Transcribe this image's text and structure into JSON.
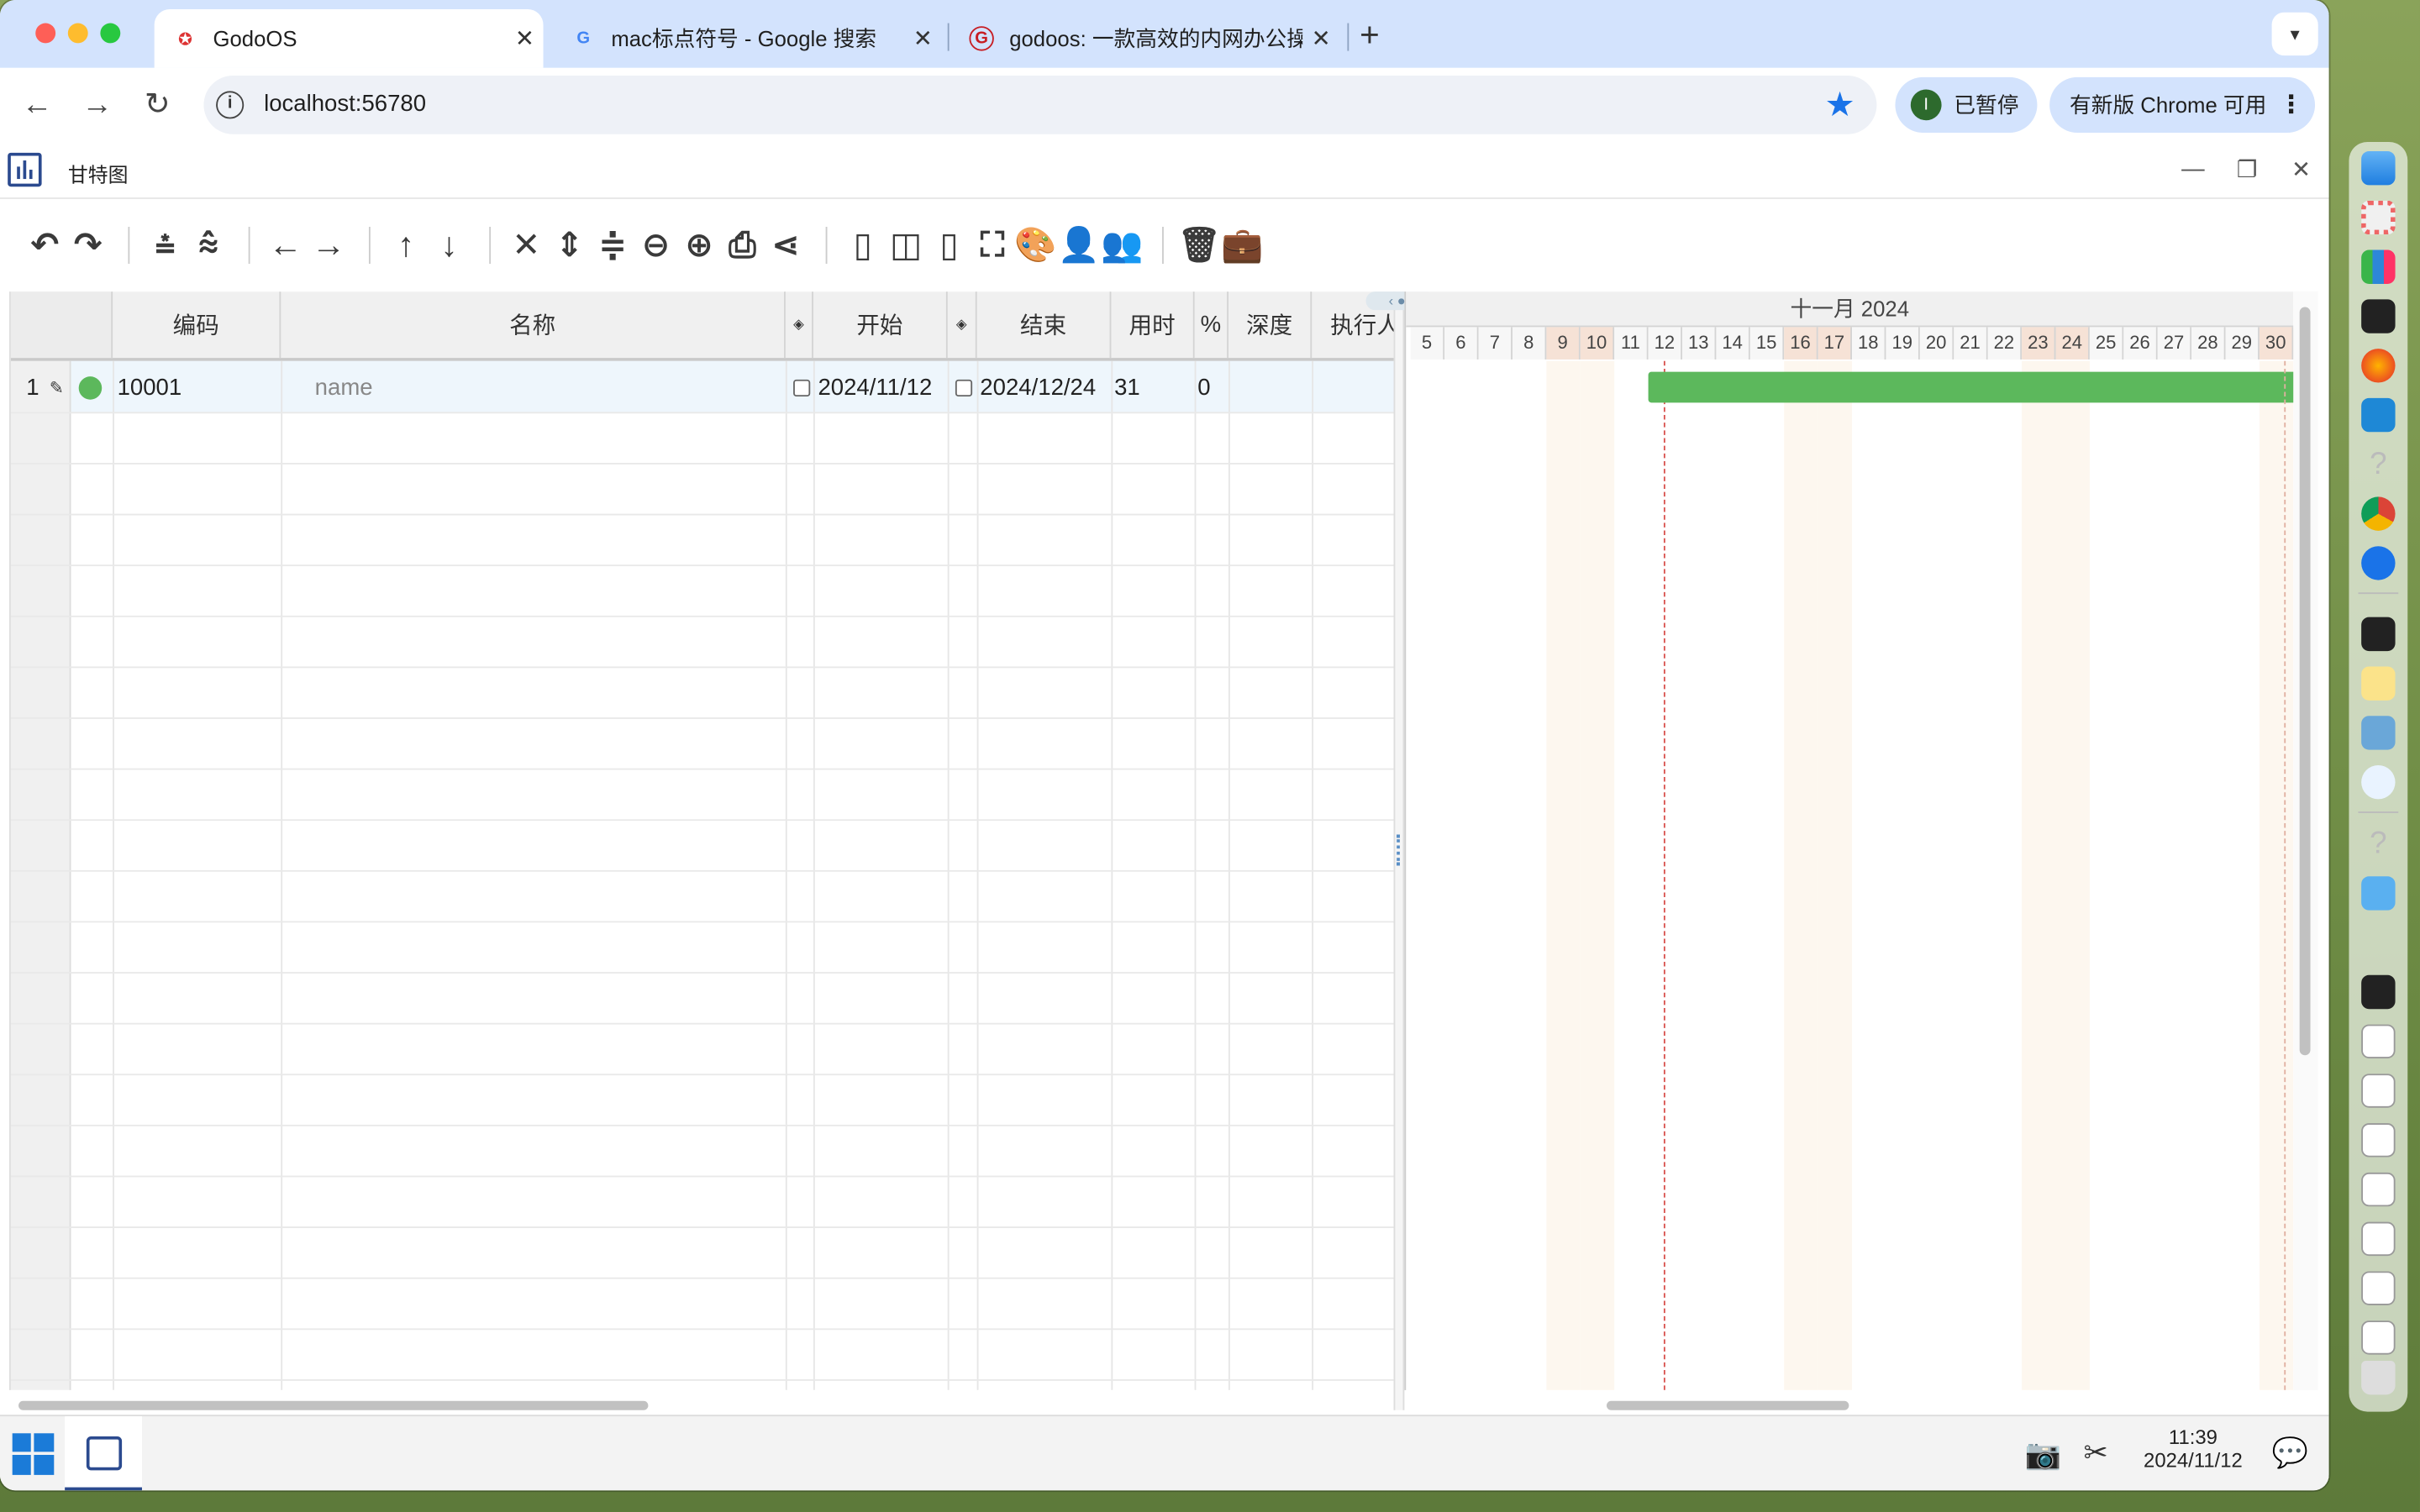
{
  "browser": {
    "tabs": [
      {
        "title": "GodoOS",
        "active": true
      },
      {
        "title": "mac标点符号 - Google 搜索",
        "active": false
      },
      {
        "title": "godoos: 一款高效的内网办公操",
        "active": false
      }
    ],
    "new_tab": "+",
    "url": "localhost:56780",
    "profile_initial": "I",
    "profile_label": "已暂停",
    "update_label": "有新版 Chrome 可用"
  },
  "app": {
    "window_title": "甘特图",
    "grid": {
      "columns": [
        "编码",
        "名称",
        "◈",
        "开始",
        "◈",
        "结束",
        "用时",
        "%",
        "深度",
        "执行人"
      ],
      "rows": [
        {
          "index": "1",
          "code": "10001",
          "name": "name",
          "start": "2024/11/12",
          "end": "2024/12/24",
          "duration": "31",
          "percent": "0",
          "depth": "",
          "assignee": ""
        }
      ]
    },
    "gantt": {
      "month_label": "十一月 2024",
      "days": [
        "5",
        "6",
        "7",
        "8",
        "9",
        "10",
        "11",
        "12",
        "13",
        "14",
        "15",
        "16",
        "17",
        "18",
        "19",
        "20",
        "21",
        "22",
        "23",
        "24",
        "25",
        "26",
        "27",
        "28",
        "29",
        "30"
      ],
      "weekend_days": [
        "9",
        "10",
        "16",
        "17",
        "23",
        "24",
        "30"
      ],
      "bar_color": "#5cb85c",
      "today": "12"
    }
  },
  "taskbar": {
    "time": "11:39",
    "date": "2024/11/12"
  }
}
